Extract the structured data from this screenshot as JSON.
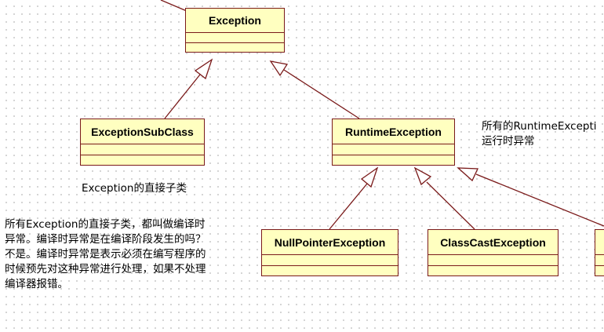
{
  "classes": {
    "exception": "Exception",
    "exception_subclass": "ExceptionSubClass",
    "runtime_exception": "RuntimeException",
    "null_pointer_exception": "NullPointerException",
    "class_cast_exception": "ClassCastException"
  },
  "notes": {
    "direct_subclass": "Exception的直接子类",
    "runtime_line1": "所有的RuntimeExcepti",
    "runtime_line2": "运行时异常",
    "checked_exception_text": "所有Exception的直接子类，都叫做编译时异常。编译时异常是在编译阶段发生的吗？不是。编译时异常是表示必须在编写程序的时候预先对这种异常进行处理，如果不处理编译器报错。"
  },
  "colors": {
    "class_fill": "#ffffc0",
    "border": "#7a1a1a",
    "grid_dot": "#c9c9c9"
  }
}
